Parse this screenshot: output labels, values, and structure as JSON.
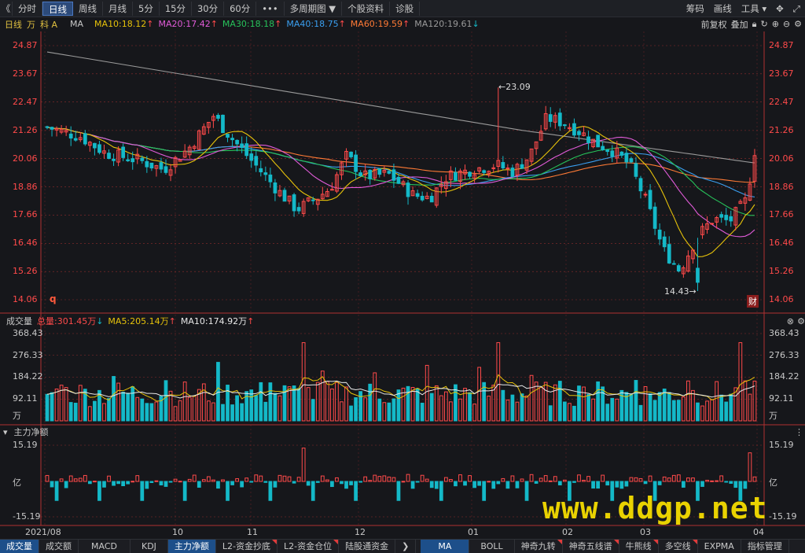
{
  "toolbar": {
    "back": "《",
    "tabs": [
      "分时",
      "日线",
      "周线",
      "月线",
      "5分",
      "15分",
      "30分",
      "60分",
      "•••",
      "多周期图 ▼",
      "个股资料",
      "诊股"
    ],
    "active_tab": "日线",
    "right": [
      "筹码",
      "画线",
      "工具 ▾"
    ]
  },
  "ma_bar": {
    "period": "日线",
    "unit": "万",
    "stock": "科 A",
    "ma_label": "MA",
    "ma10": "MA10:18.12",
    "ma20": "MA20:17.42",
    "ma30": "MA30:18.18",
    "ma40": "MA40:18.75",
    "ma60": "MA60:19.59",
    "ma120": "MA120:19.61",
    "adjust": "前复权",
    "stack": "叠加"
  },
  "colors": {
    "up": "#ff4a4a",
    "down": "#14b9c8",
    "ma10": "#e6c20a",
    "ma20": "#e05bd8",
    "ma30": "#27c25a",
    "ma40": "#3a9ff0",
    "ma60": "#ff7a35",
    "ma120": "#9a9a9a",
    "grid": "#b03030",
    "accent": "#4a78c2"
  },
  "price_axis": [
    "24.87",
    "23.67",
    "22.47",
    "21.26",
    "20.06",
    "18.86",
    "17.66",
    "16.46",
    "15.26",
    "14.06"
  ],
  "annotations": {
    "high": "←23.09",
    "low": "14.43→",
    "q": "q",
    "cai": "财"
  },
  "volume_bar": {
    "label": "成交量",
    "total": "总量:301.45万",
    "ma5": "MA5:205.14万",
    "ma10": "MA10:174.92万",
    "axis": [
      "368.43",
      "276.33",
      "184.22",
      "92.11",
      "万"
    ]
  },
  "moneyflow": {
    "label": "主力净额",
    "axis": [
      "15.19",
      "亿",
      "-15.19"
    ]
  },
  "x_axis": [
    "2021/08",
    "10",
    "11",
    "12",
    "01",
    "02",
    "03",
    "04"
  ],
  "bottom_tabs": [
    "成交量",
    "成交额",
    "MACD",
    "KDJ",
    "主力净额",
    "L2-资金抄底",
    "L2-资金仓位",
    "陆股通资金",
    "❯",
    "MA",
    "BOLL",
    "神奇九转",
    "神奇五线谱",
    "牛熊线",
    "多空线",
    "EXPMA",
    "指标管理"
  ],
  "watermark": "www.ddgp.net"
}
